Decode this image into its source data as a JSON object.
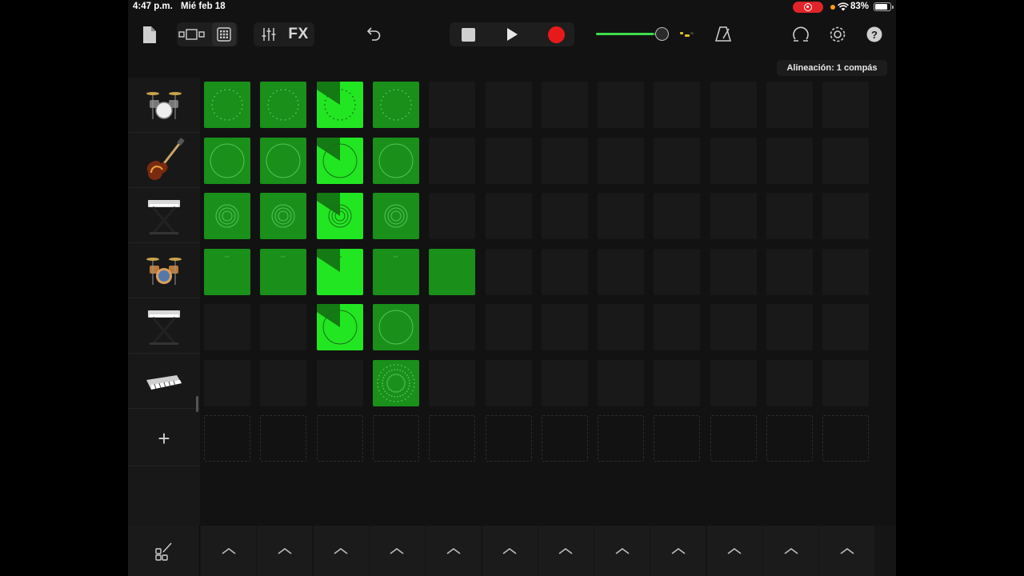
{
  "status_bar": {
    "time": "4:47 p.m.",
    "date": "Mié feb 18",
    "battery": "83%",
    "battery_level": 0.83
  },
  "toolbar": {
    "icons": [
      "my-songs-icon",
      "track-view-icon",
      "live-loops-grid-icon",
      "mixer-icon",
      "undo-icon",
      "stop-icon",
      "play-icon",
      "record-icon",
      "metronome-icon",
      "loop-browser-icon",
      "settings-icon",
      "help-icon"
    ],
    "fx_label": "FX",
    "volume_level": 0.82,
    "record_color": "#e8191b"
  },
  "snap_label": "Alineación: 1 compás",
  "tracks": [
    {
      "instrument": "drum-kit-icon"
    },
    {
      "instrument": "bass-guitar-icon"
    },
    {
      "instrument": "keyboard-stand-icon"
    },
    {
      "instrument": "drum-kit-icon"
    },
    {
      "instrument": "keyboard-stand-icon"
    },
    {
      "instrument": "synth-keyboard-icon"
    }
  ],
  "add_track_label": "+",
  "colors": {
    "cell_on": "#1a8f1a",
    "cell_playing": "#22e622",
    "cell_empty": "#191919"
  },
  "grid": {
    "columns": 12,
    "rows": [
      [
        "dots",
        "dots",
        "play-dots",
        "dots",
        null,
        null,
        null,
        null,
        null,
        null,
        null,
        null
      ],
      [
        "circle",
        "circle",
        "play-circle",
        "circle",
        null,
        null,
        null,
        null,
        null,
        null,
        null,
        null
      ],
      [
        "rings",
        "rings",
        "play-rings",
        "rings",
        null,
        null,
        null,
        null,
        null,
        null,
        null,
        null
      ],
      [
        "small",
        "small",
        "play-small",
        "small",
        "blank",
        null,
        null,
        null,
        null,
        null,
        null,
        null
      ],
      [
        null,
        null,
        "play-circle",
        "circle",
        null,
        null,
        null,
        null,
        null,
        null,
        null,
        null
      ],
      [
        null,
        null,
        null,
        "dots-big",
        null,
        null,
        null,
        null,
        null,
        null,
        null,
        null
      ]
    ]
  },
  "bottom": {
    "edit_icon": "cell-edit-icon",
    "trigger_icon": "chevron-up-icon",
    "trigger_count": 12
  }
}
